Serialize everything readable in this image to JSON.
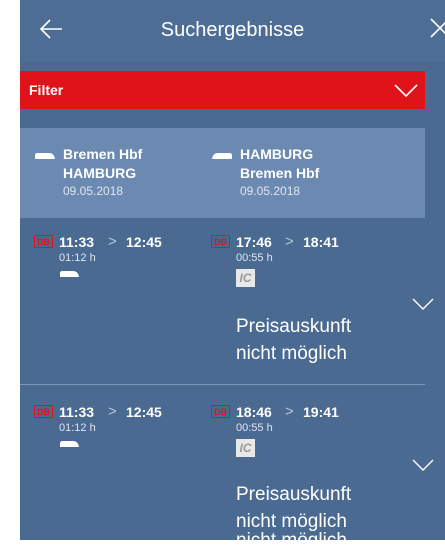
{
  "header": {
    "title": "Suchergebnisse",
    "back_icon": "arrow-left-icon",
    "close_icon": "close-icon"
  },
  "filter": {
    "label": "Filter",
    "chevron_icon": "chevron-down-icon",
    "accent_color": "#e0131a"
  },
  "route": {
    "outbound": {
      "from": "Bremen Hbf",
      "to": "HAMBURG",
      "date": "09.05.2018"
    },
    "return": {
      "from": "HAMBURG",
      "to": "Bremen Hbf",
      "date": "09.05.2018"
    }
  },
  "connections": [
    {
      "outbound": {
        "operator": "DB",
        "depart": "11:33",
        "arrive": "12:45",
        "duration": "01:12 h",
        "train_icon": "ice-train-icon"
      },
      "return": {
        "operator": "DB",
        "depart": "17:46",
        "arrive": "18:41",
        "duration": "00:55 h",
        "product": "IC"
      },
      "price_text_1": "Preisauskunft",
      "price_text_2": "nicht möglich"
    },
    {
      "outbound": {
        "operator": "DB",
        "depart": "11:33",
        "arrive": "12:45",
        "duration": "01:12 h",
        "train_icon": "ice-train-icon"
      },
      "return": {
        "operator": "DB",
        "depart": "18:46",
        "arrive": "19:41",
        "duration": "00:55 h",
        "product": "IC"
      },
      "price_text_1": "Preisauskunft",
      "price_text_2": "nicht möglich",
      "price_text_3": "nicht möglich"
    }
  ]
}
